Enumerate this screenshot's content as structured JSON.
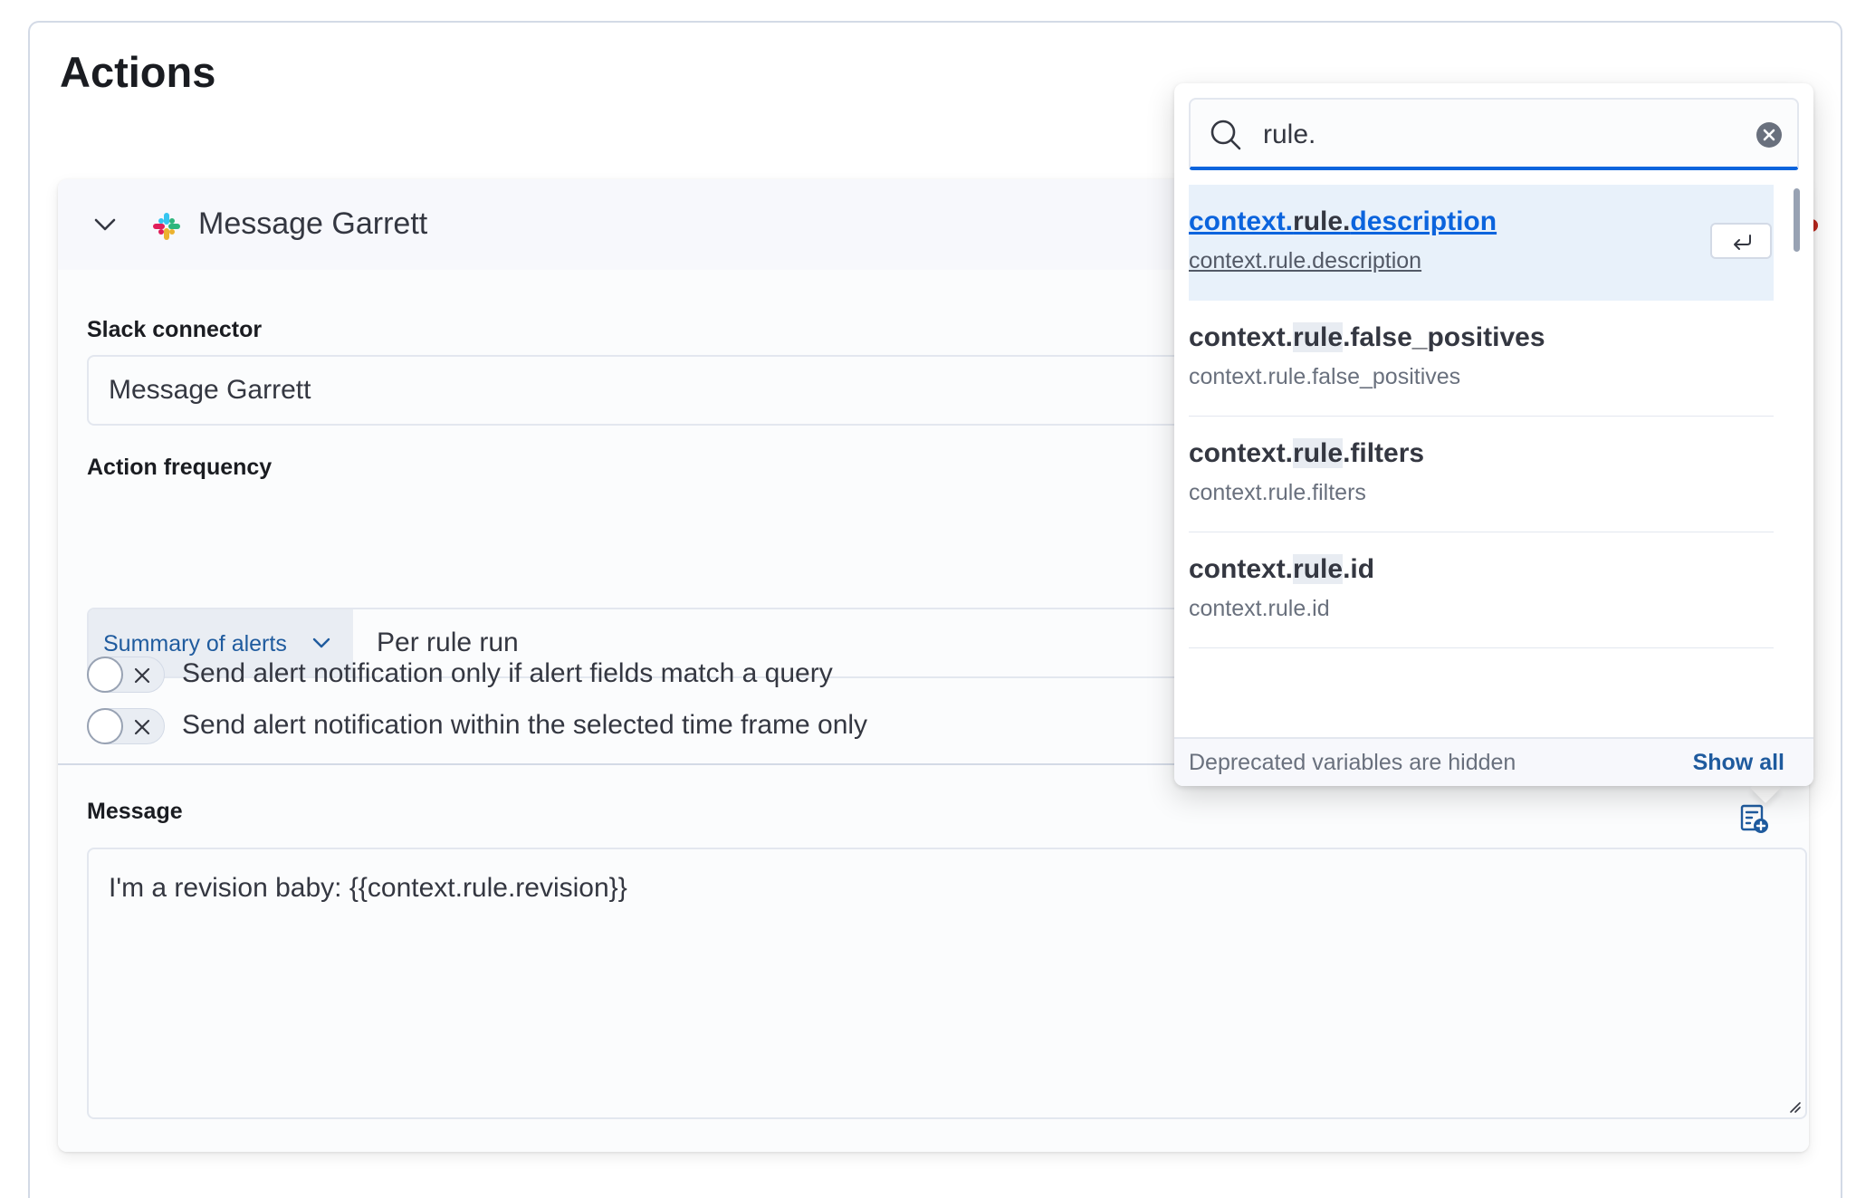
{
  "page": {
    "title": "Actions"
  },
  "action_card": {
    "title": "Message Garrett",
    "connector_label": "Slack connector",
    "connector_value": "Message Garrett",
    "frequency_label": "Action frequency",
    "frequency_mode": "Summary of alerts",
    "frequency_value": "Per rule run",
    "toggles": [
      {
        "label": "Send alert notification only if alert fields match a query",
        "on": false
      },
      {
        "label": "Send alert notification within the selected time frame only",
        "on": false
      }
    ],
    "message_label": "Message",
    "message_value": "I'm a revision baby: {{context.rule.revision}}"
  },
  "variable_popover": {
    "search_value": "rule.",
    "options": [
      {
        "pre": "context.",
        "match": "rule.",
        "post": "description",
        "sub": "context.rule.description",
        "selected": true
      },
      {
        "pre": "context.",
        "match": "rule",
        "post": ".false_positives",
        "sub": "context.rule.false_positives",
        "selected": false
      },
      {
        "pre": "context.",
        "match": "rule",
        "post": ".filters",
        "sub": "context.rule.filters",
        "selected": false
      },
      {
        "pre": "context.",
        "match": "rule",
        "post": ".id",
        "sub": "context.rule.id",
        "selected": false
      }
    ],
    "footer_note": "Deprecated variables are hidden",
    "footer_action": "Show all"
  },
  "colors": {
    "accent": "#0b64dd",
    "link": "#1f5b9e",
    "selected_bg": "#e8f1fa"
  },
  "icons": [
    "chevron-down-icon",
    "slack-icon",
    "search-icon",
    "clear-icon",
    "enter-key-icon",
    "cross-icon",
    "add-variable-icon"
  ]
}
